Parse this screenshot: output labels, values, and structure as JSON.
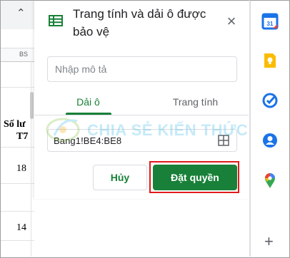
{
  "panel": {
    "title": "Trang tính và dải ô được bảo vệ",
    "description_placeholder": "Nhập mô tả",
    "tabs": [
      {
        "label": "Dải ô",
        "active": true
      },
      {
        "label": "Trang tính",
        "active": false
      }
    ],
    "range_value": "Bang1!BE4:BE8",
    "cancel_label": "Hủy",
    "set_permissions_label": "Đặt quyền"
  },
  "sheet": {
    "column_header": "BS",
    "header_cell_line1": "Số lư",
    "header_cell_line2": "T7",
    "cell_values": [
      "18",
      "14"
    ]
  },
  "watermark": {
    "text": "CHIA SẺ KIẾN THỨC"
  },
  "addon_sidebar": {
    "icons": [
      "calendar-icon",
      "keep-icon",
      "tasks-icon",
      "contacts-icon",
      "maps-icon"
    ],
    "calendar_badge": "31"
  },
  "colors": {
    "accent_green": "#188038",
    "highlight_red": "#e21a1a",
    "watermark_blue": "#32b6e9"
  }
}
